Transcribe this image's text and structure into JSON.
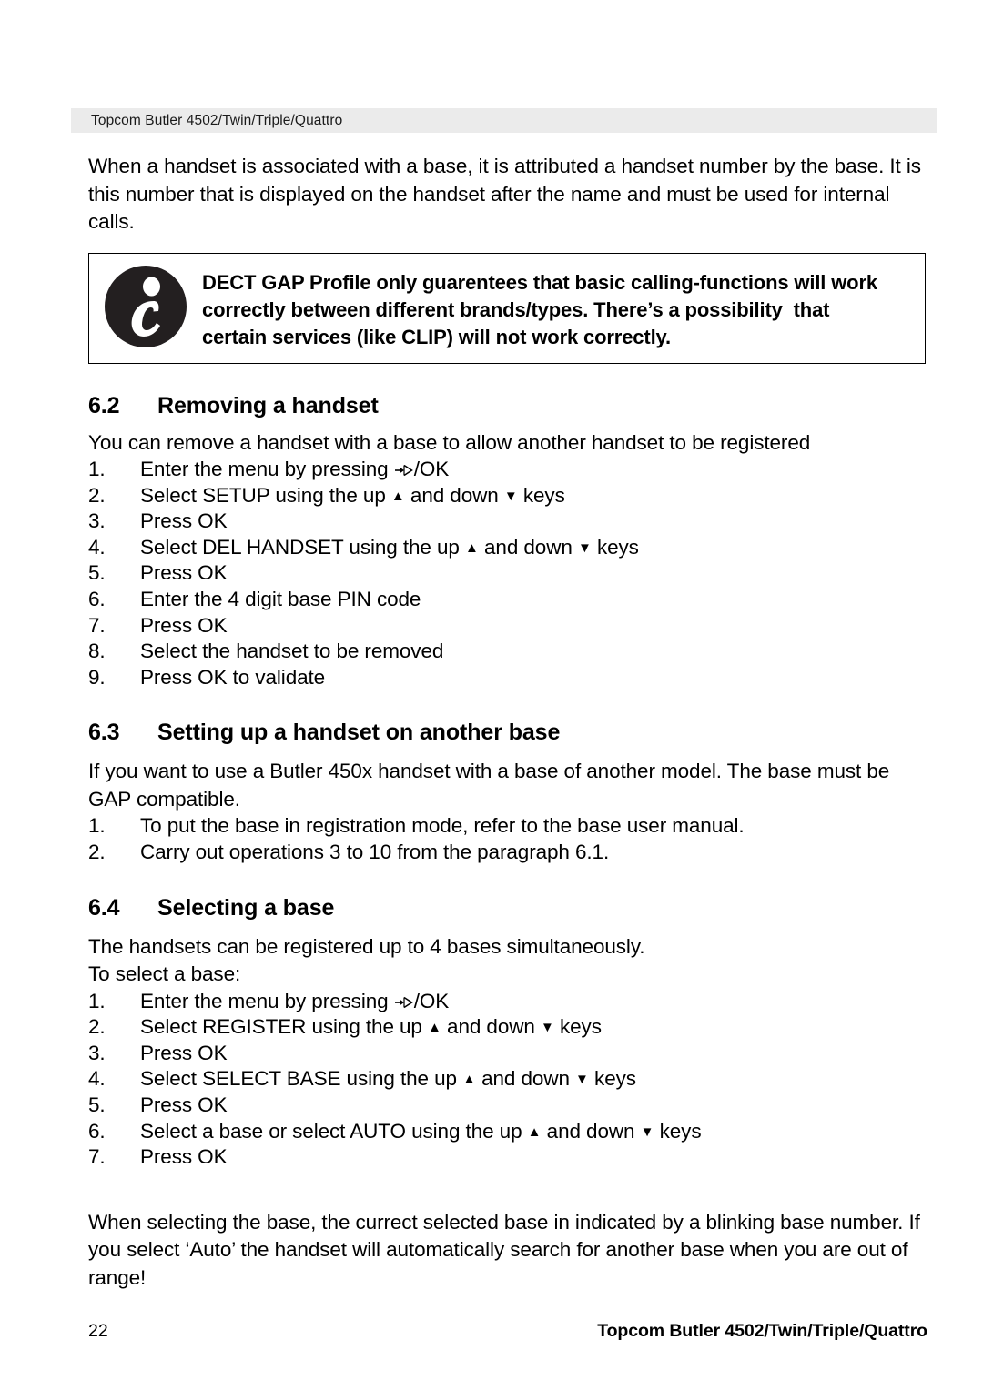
{
  "header": {
    "running_head": "Topcom Butler 4502/Twin/Triple/Quattro"
  },
  "intro": {
    "paragraph": "When a handset is associated with a base, it is attributed a handset number by the base. It is this number that is displayed on the handset after the name and must be used for internal calls."
  },
  "note": {
    "icon_name": "information-icon",
    "icon_letter": "i",
    "line1": "DECT GAP Profile only guarentees that basic calling-functions will work",
    "line2": "correctly between different brands/types. There’s a possibility  that",
    "line3": "certain services (like CLIP) will not work correctly."
  },
  "sections": [
    {
      "number": "6.2",
      "title": "Removing a handset",
      "intro": "You can remove a handset with a base to allow another handset to be registered",
      "steps": [
        {
          "idx": "1.",
          "pre": "Enter the menu by pressing ",
          "menu_glyph": true,
          "post": "/OK"
        },
        {
          "idx": "2.",
          "pre": "Select SETUP using the up ",
          "up": "▲",
          "mid": " and down ",
          "down": "▼",
          "post": " keys"
        },
        {
          "idx": "3.",
          "pre": "Press OK"
        },
        {
          "idx": "4.",
          "pre": "Select DEL HANDSET using the up ",
          "up": "▲",
          "mid": " and down ",
          "down": "▼",
          "post": " keys"
        },
        {
          "idx": "5.",
          "pre": "Press OK"
        },
        {
          "idx": "6.",
          "pre": "Enter the 4 digit base PIN code"
        },
        {
          "idx": "7.",
          "pre": "Press OK"
        },
        {
          "idx": "8.",
          "pre": "Select the handset to be removed"
        },
        {
          "idx": "9.",
          "pre": "Press OK to validate"
        }
      ]
    },
    {
      "number": "6.3",
      "title": "Setting up a handset on another base",
      "intro": "If you want to use a Butler 450x handset with a base of another model. The base must be GAP compatible.",
      "steps": [
        {
          "idx": "1.",
          "pre": "To put the base in registration mode, refer to the base user manual."
        },
        {
          "idx": "2.",
          "pre": "Carry out operations 3 to 10 from the paragraph 6.1."
        }
      ]
    },
    {
      "number": "6.4",
      "title": "Selecting a base",
      "intro": "The handsets can be registered up to 4 bases simultaneously.",
      "intro2": "To select a base:",
      "steps": [
        {
          "idx": "1.",
          "pre": "Enter the menu by pressing ",
          "menu_glyph": true,
          "post": "/OK"
        },
        {
          "idx": "2.",
          "pre": "Select REGISTER using the up ",
          "up": "▲",
          "mid": " and down ",
          "down": "▼",
          "post": " keys"
        },
        {
          "idx": "3.",
          "pre": "Press OK"
        },
        {
          "idx": "4.",
          "pre": "Select SELECT BASE using the up ",
          "up": "▲",
          "mid": " and down ",
          "down": "▼",
          "post": " keys"
        },
        {
          "idx": "5.",
          "pre": "Press OK"
        },
        {
          "idx": "6.",
          "pre": "Select a base or select AUTO using the up ",
          "up": "▲",
          "mid": " and down ",
          "down": "▼",
          "post": " keys"
        },
        {
          "idx": "7.",
          "pre": "Press OK"
        }
      ],
      "closing": "When selecting the base, the currect selected base in indicated by a blinking base number. If you select ‘Auto’ the handset will automatically search for another base when you are out of range!"
    }
  ],
  "footer": {
    "page_number": "22",
    "doc_title": "Topcom Butler 4502/Twin/Triple/Quattro"
  },
  "colors": {
    "header_band": "#ebebeb",
    "text": "#000000",
    "icon_fill": "#231f20"
  }
}
